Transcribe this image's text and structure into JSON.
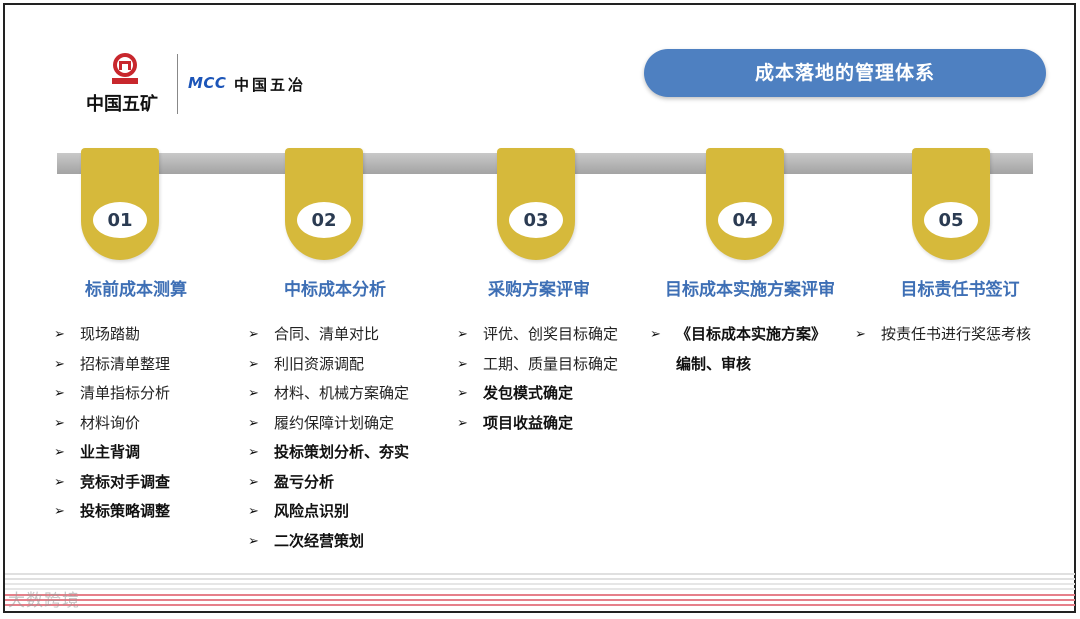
{
  "logos": {
    "minmetals": "中国五矿",
    "mcc_mark": "MCC",
    "mcc_name": "中国五冶"
  },
  "title": "成本落地的管理体系",
  "steps": [
    {
      "number": "01",
      "title": "标前成本测算",
      "items": [
        {
          "text": "现场踏勘",
          "bold": false
        },
        {
          "text": "招标清单整理",
          "bold": false
        },
        {
          "text": "清单指标分析",
          "bold": false
        },
        {
          "text": "材料询价",
          "bold": false
        },
        {
          "text": "业主背调",
          "bold": true
        },
        {
          "text": "竞标对手调查",
          "bold": true
        },
        {
          "text": "投标策略调整",
          "bold": true
        }
      ]
    },
    {
      "number": "02",
      "title": "中标成本分析",
      "items": [
        {
          "text": "合同、清单对比",
          "bold": false
        },
        {
          "text": "利旧资源调配",
          "bold": false
        },
        {
          "text": "材料、机械方案确定",
          "bold": false
        },
        {
          "text": "履约保障计划确定",
          "bold": false
        },
        {
          "text": "投标策划分析、夯实",
          "bold": true
        },
        {
          "text": "盈亏分析",
          "bold": true
        },
        {
          "text": "风险点识别",
          "bold": true
        },
        {
          "text": "二次经营策划",
          "bold": true
        }
      ]
    },
    {
      "number": "03",
      "title": "采购方案评审",
      "items": [
        {
          "text": "评优、创奖目标确定",
          "bold": false
        },
        {
          "text": "工期、质量目标确定",
          "bold": false
        },
        {
          "text": "发包模式确定",
          "bold": true
        },
        {
          "text": "项目收益确定",
          "bold": true
        }
      ]
    },
    {
      "number": "04",
      "title": "目标成本实施方案评审",
      "items": [
        {
          "text": "《目标成本实施方案》",
          "text2": "编制、审核",
          "bold": true
        }
      ]
    },
    {
      "number": "05",
      "title": "目标责任书签订",
      "items": [
        {
          "text": "按责任书进行奖惩考核",
          "bold": false
        }
      ]
    }
  ],
  "arrow_glyph": "➢",
  "footer": {
    "watermark": "大数跨境"
  },
  "colors": {
    "title_pill": "#4e80c1",
    "step_title": "#3e6fb5",
    "tab_gold": "#d6b93b",
    "bar_gray": "#b5b5b5",
    "stripe_red": "#e6808a"
  }
}
